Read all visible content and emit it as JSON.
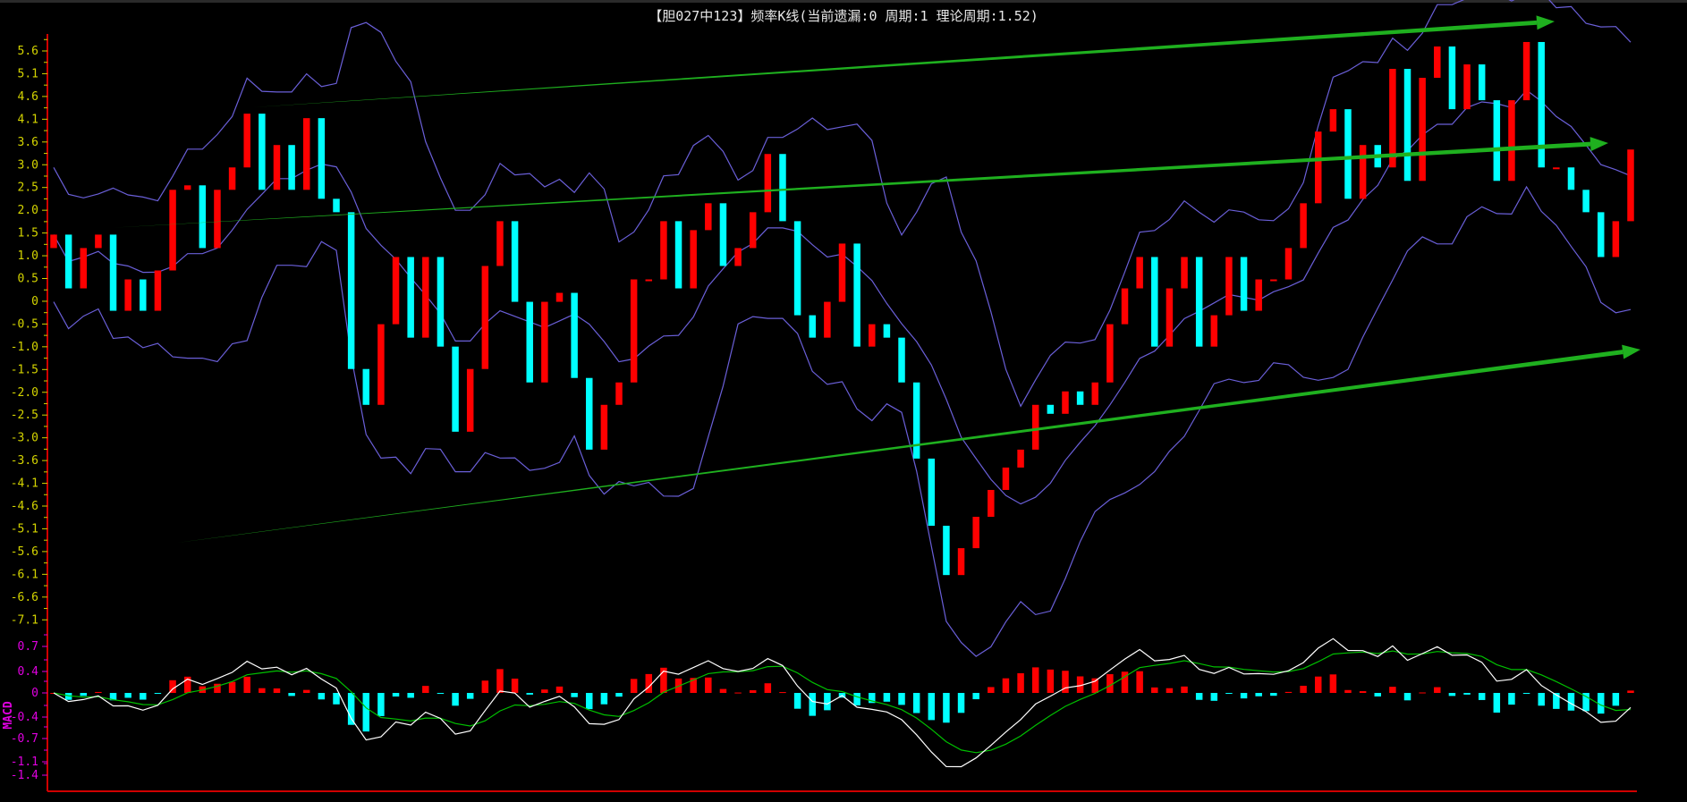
{
  "title": "【胆027中123】频率K线(当前遗漏:0 周期:1 理论周期:1.52)",
  "chart_data": {
    "type": "candlestick",
    "title": "【胆027中123】频率K线(当前遗漏:0 周期:1 理论周期:1.52)",
    "main_yticks": [
      "5.6",
      "5.1",
      "4.6",
      "4.1",
      "3.6",
      "3.0",
      "2.5",
      "2.0",
      "1.5",
      "1.0",
      "0.5",
      "0",
      "-0.5",
      "-1.0",
      "-1.5",
      "-2.0",
      "-2.5",
      "-3.0",
      "-3.6",
      "-4.1",
      "-4.6",
      "-5.1",
      "-5.6",
      "-6.1",
      "-6.6",
      "-7.1"
    ],
    "main_ylim": [
      -7.1,
      5.6
    ],
    "macd_label": "MACD",
    "macd_yticks": [
      "0.7",
      "0.4",
      "0",
      "-0.4",
      "-0.7",
      "-1.1",
      "-1.4"
    ],
    "macd_ylim": [
      -1.4,
      0.7
    ],
    "closes": [
      1.5,
      0.3,
      1.2,
      1.5,
      -0.2,
      0.5,
      -0.2,
      0.7,
      2.5,
      2.6,
      1.2,
      2.5,
      3.0,
      4.2,
      2.5,
      3.5,
      2.5,
      4.1,
      2.3,
      2.0,
      -1.5,
      -2.3,
      -0.5,
      1.0,
      -0.8,
      1.0,
      -1.0,
      -2.9,
      -1.5,
      0.8,
      1.8,
      0,
      -1.8,
      0,
      0.2,
      -1.7,
      -3.3,
      -2.3,
      -1.8,
      0.5,
      0.5,
      1.8,
      0.3,
      1.6,
      2.2,
      0.8,
      1.2,
      2.0,
      3.3,
      1.8,
      -0.3,
      -0.8,
      0,
      1.3,
      -1.0,
      -0.5,
      -0.8,
      -1.8,
      -3.5,
      -5.0,
      -6.1,
      -5.5,
      -4.8,
      -4.2,
      -3.7,
      -3.3,
      -2.3,
      -2.5,
      -2.0,
      -2.3,
      -1.8,
      -0.5,
      0.3,
      1.0,
      -1.0,
      0.3,
      1.0,
      -1.0,
      -0.3,
      1.0,
      -0.2,
      0.5,
      0.5,
      1.2,
      2.2,
      3.8,
      4.3,
      2.3,
      3.5,
      3.0,
      5.2,
      2.7,
      5.0,
      5.7,
      4.3,
      5.3,
      4.5,
      2.7,
      4.5,
      5.8,
      3.0,
      3.0,
      2.5,
      2.0,
      1.0,
      1.8,
      3.4
    ],
    "colors": {
      "up": "#ff0000",
      "down": "#00ffff",
      "bands": "#6a5fd8",
      "dif": "#ffffff",
      "dea": "#00c000",
      "trend": "#1fb01f"
    },
    "trend_arrows": 3
  }
}
